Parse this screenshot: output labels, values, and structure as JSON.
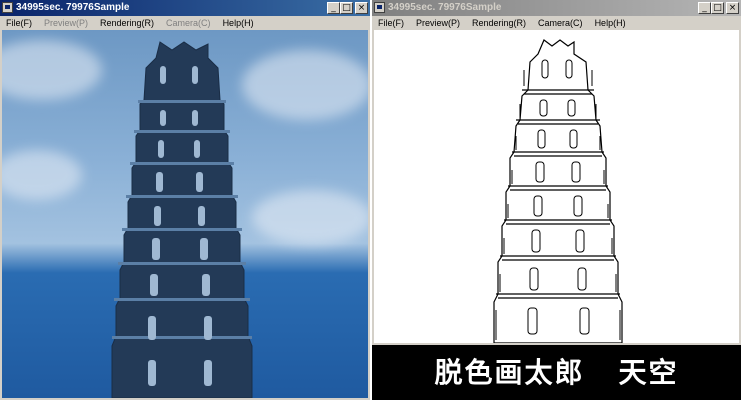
{
  "left_window": {
    "title": "34995sec. 79976Sample",
    "menu": [
      {
        "label": "File(F)",
        "disabled": false
      },
      {
        "label": "Preview(P)",
        "disabled": true
      },
      {
        "label": "Rendering(R)",
        "disabled": false
      },
      {
        "label": "Camera(C)",
        "disabled": true
      },
      {
        "label": "Help(H)",
        "disabled": false
      }
    ],
    "buttons": {
      "minimize": "_",
      "maximize": "□",
      "close": "×"
    }
  },
  "right_window": {
    "title": "34995sec. 79976Sample",
    "menu": [
      {
        "label": "File(F)",
        "disabled": false
      },
      {
        "label": "Preview(P)",
        "disabled": false
      },
      {
        "label": "Rendering(R)",
        "disabled": false
      },
      {
        "label": "Camera(C)",
        "disabled": false
      },
      {
        "label": "Help(H)",
        "disabled": false
      }
    ],
    "buttons": {
      "minimize": "_",
      "maximize": "□",
      "close": "×"
    }
  },
  "caption": {
    "left": "脱色画太郎",
    "right": "天空"
  },
  "colors": {
    "active_title": "#0a246a",
    "inactive_title": "#808080",
    "sky": "#8ab0d6",
    "sea": "#1f5aa0",
    "tower": "#253d5a"
  }
}
